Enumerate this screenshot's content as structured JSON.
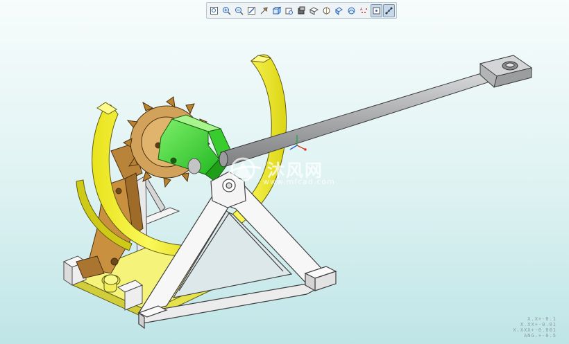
{
  "toolbar": {
    "buttons": [
      {
        "icon": "zoom-fit-icon"
      },
      {
        "icon": "zoom-in-icon"
      },
      {
        "icon": "zoom-out-icon"
      },
      {
        "icon": "repaint-icon"
      },
      {
        "icon": "pan-icon"
      },
      {
        "icon": "saved-views-icon"
      },
      {
        "icon": "view-manager-icon"
      },
      {
        "icon": "display-style-icon"
      },
      {
        "icon": "datum-planes-icon"
      },
      {
        "icon": "datum-axes-icon"
      },
      {
        "icon": "point-display-icon"
      },
      {
        "icon": "csys-display-icon"
      },
      {
        "icon": "annotation-display-icon"
      },
      {
        "icon": "spin-center-icon",
        "active": true
      },
      {
        "icon": "orient-mode-icon",
        "active": true
      }
    ]
  },
  "watermark": {
    "name": "沐风网",
    "url": "www.mfcad.com"
  },
  "tolerance": {
    "line1": "X.X+-0.1",
    "line2": "X.XX+-0.01",
    "line3": "X.XXX+-0.001",
    "line4": "ANG.+-0.5"
  },
  "colors": {
    "background_top": "#f7fcfc",
    "background_bottom": "#bfe5e7",
    "frame": "#ffffff",
    "ring": "#f2ef2a",
    "gear": "#d19a4a",
    "arm": "#c88e3d",
    "hub": "#3ed63a",
    "rod": "#b8b9ba"
  }
}
